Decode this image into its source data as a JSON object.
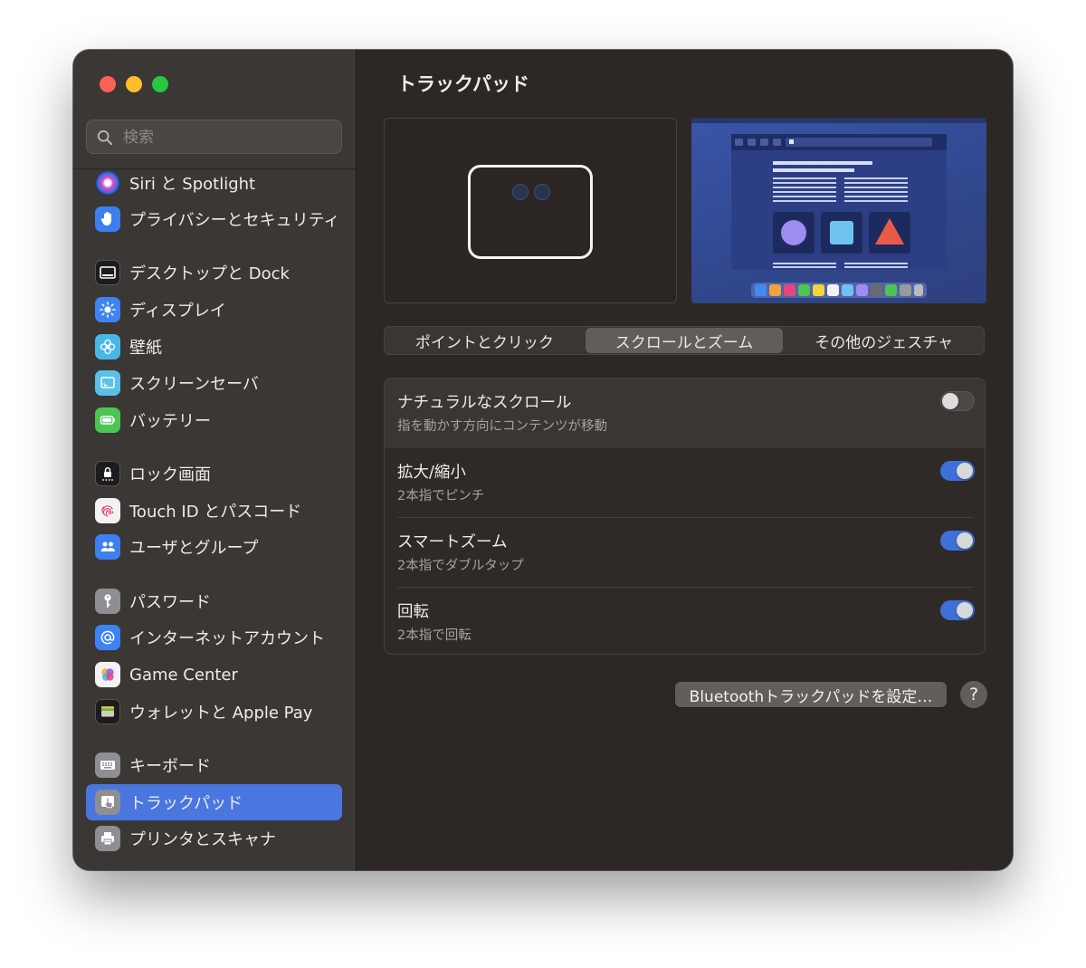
{
  "window": {
    "traffic_lights": {
      "close_color": "#fe5f57",
      "minimize_color": "#febc2e",
      "zoom_color": "#28c840"
    }
  },
  "sidebar": {
    "search": {
      "placeholder": "検索",
      "icon": "magnifyingglass"
    },
    "items": [
      {
        "label": "Siri と Spotlight",
        "icon": "siri-icon",
        "color": "#7a3fd0"
      },
      {
        "label": "プライバシーとセキュリティ",
        "icon": "hand-raised-icon",
        "color": "#3d7ff0"
      },
      {
        "label": "デスクトップと Dock",
        "icon": "dock-icon",
        "color": "#1c1c1e"
      },
      {
        "label": "ディスプレイ",
        "icon": "sun-icon",
        "color": "#3d84f2"
      },
      {
        "label": "壁紙",
        "icon": "flower-icon",
        "color": "#49b6e8"
      },
      {
        "label": "スクリーンセーバ",
        "icon": "screensaver-icon",
        "color": "#5bc0e8"
      },
      {
        "label": "バッテリー",
        "icon": "battery-icon",
        "color": "#4cc553"
      },
      {
        "label": "ロック画面",
        "icon": "lock-icon",
        "color": "#1c1c1e"
      },
      {
        "label": "Touch ID とパスコード",
        "icon": "fingerprint-icon",
        "color": "#f2f2f2"
      },
      {
        "label": "ユーザとグループ",
        "icon": "users-icon",
        "color": "#3d7ff0"
      },
      {
        "label": "パスワード",
        "icon": "key-icon",
        "color": "#8e8e93"
      },
      {
        "label": "インターネットアカウント",
        "icon": "at-icon",
        "color": "#3d84f2"
      },
      {
        "label": "Game Center",
        "icon": "game-center-icon",
        "color": "#f2f2f2"
      },
      {
        "label": "ウォレットと Apple Pay",
        "icon": "wallet-icon",
        "color": "#1c1c1e"
      },
      {
        "label": "キーボード",
        "icon": "keyboard-icon",
        "color": "#8e8e93"
      },
      {
        "label": "トラックパッド",
        "icon": "trackpad-icon",
        "color": "#8e8e93",
        "selected": true
      },
      {
        "label": "プリンタとスキャナ",
        "icon": "printer-icon",
        "color": "#8e8e93"
      }
    ]
  },
  "main": {
    "title": "トラックパッド",
    "tabs": [
      {
        "label": "ポイントとクリック",
        "active": false
      },
      {
        "label": "スクロールとズーム",
        "active": true
      },
      {
        "label": "その他のジェスチャ",
        "active": false
      }
    ],
    "settings": [
      {
        "label": "ナチュラルなスクロール",
        "sublabel": "指を動かす方向にコンテンツが移動",
        "enabled": false
      },
      {
        "label": "拡大/縮小",
        "sublabel": "2本指でピンチ",
        "enabled": true
      },
      {
        "label": "スマートズーム",
        "sublabel": "2本指でダブルタップ",
        "enabled": true
      },
      {
        "label": "回転",
        "sublabel": "2本指で回転",
        "enabled": true
      }
    ],
    "bluetooth_button": "Bluetoothトラックパッドを設定…",
    "help_button": "?",
    "accent_color": "#3f6fd9"
  }
}
